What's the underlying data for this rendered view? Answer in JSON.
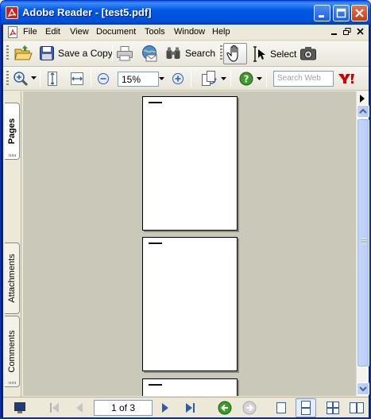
{
  "window": {
    "title": "Adobe Reader - [test5.pdf]"
  },
  "menubar": {
    "items": [
      "File",
      "Edit",
      "View",
      "Document",
      "Tools",
      "Window",
      "Help"
    ]
  },
  "toolbar": {
    "save_copy_label": "Save a Copy",
    "search_label": "Search",
    "select_label": "Select",
    "zoom_value": "15%",
    "search_web_placeholder": "Search Web"
  },
  "nav_panel": {
    "tabs": [
      "Pages",
      "Attachments",
      "Comments"
    ]
  },
  "document": {
    "pages_visible": 3
  },
  "statusbar": {
    "page_indicator": "1 of 3"
  },
  "colors": {
    "title_blue": "#0058e6",
    "doc_background": "#cac8b8",
    "adobe_red": "#d0211c",
    "yahoo_red": "#cc0000",
    "nav_green": "#3c9a2b"
  }
}
